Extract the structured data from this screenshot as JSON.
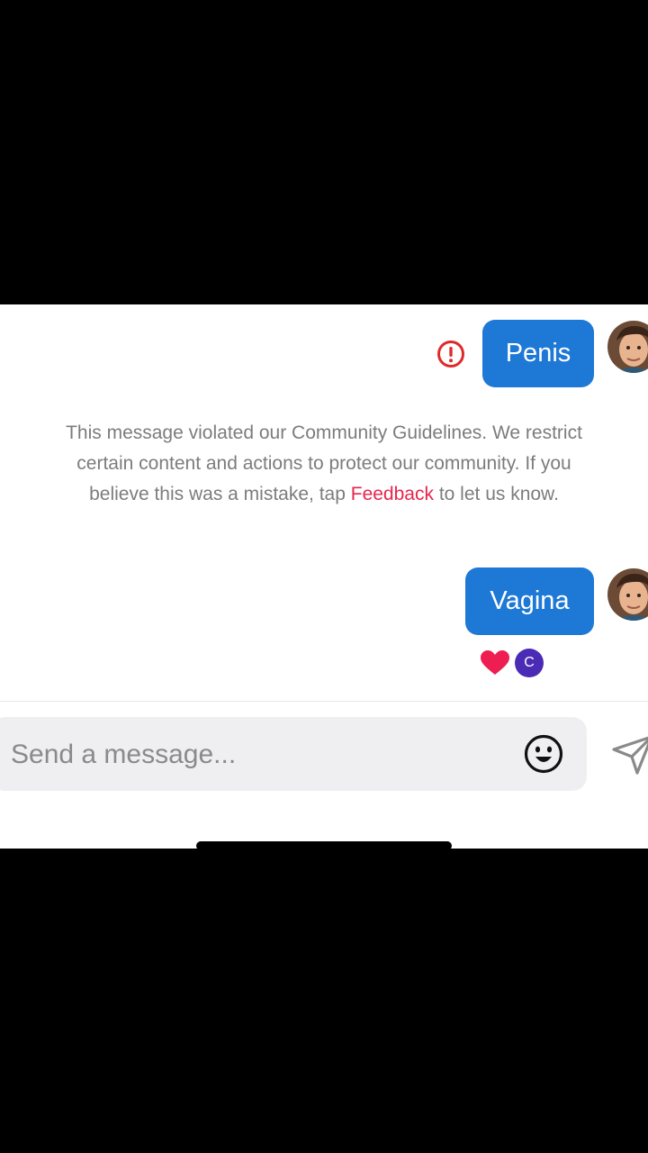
{
  "messages": [
    {
      "text": "Penis",
      "flagged": true
    },
    {
      "text": "Vagina",
      "flagged": false
    }
  ],
  "notice": {
    "text_before": "This message violated our Community Guidelines. We restrict certain content and actions to protect our community. If you believe this was a mistake, tap",
    "link_text": "Feedback",
    "text_after": "to let us know."
  },
  "reactions": {
    "heart_icon": "heart-icon",
    "user_initial": "C"
  },
  "composer": {
    "placeholder": "Send a message..."
  },
  "icons": {
    "warning": "warning-icon",
    "emoji": "emoji-icon",
    "send": "send-icon",
    "avatar": "user-avatar"
  },
  "colors": {
    "bubble": "#1e78d6",
    "link": "#e8244e",
    "warning": "#e02a2a",
    "heart": "#ee1d52",
    "reaction_badge": "#4a2bb5"
  }
}
